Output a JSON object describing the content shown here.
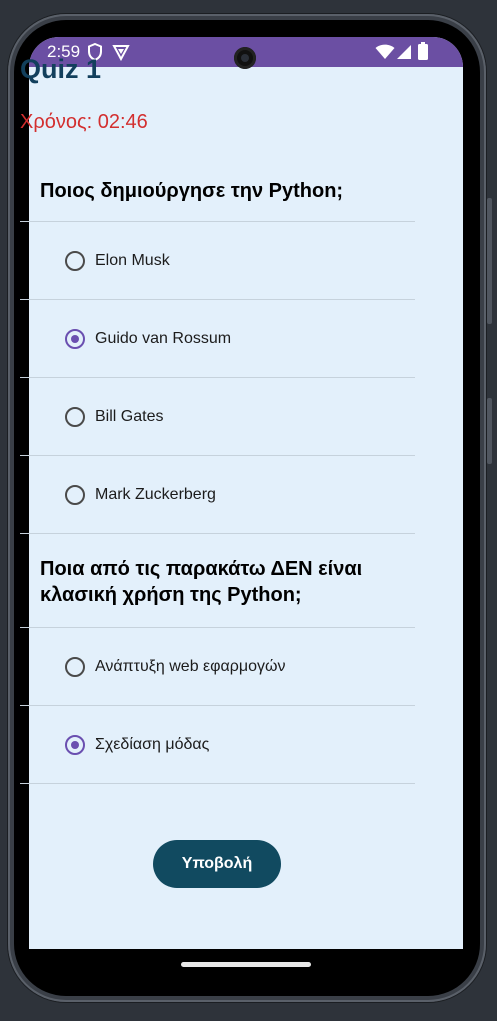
{
  "status_bar": {
    "time": "2:59",
    "left_icons": [
      "shield-icon",
      "vpn-icon"
    ],
    "right_icons": [
      "wifi-icon",
      "signal-icon",
      "battery-icon"
    ],
    "color": "#6b4fa3"
  },
  "quiz": {
    "title": "Quiz 1",
    "timer": "Χρόνος: 02:46",
    "questions": [
      {
        "text": "Ποιος δημιούργησε την Python;",
        "options": [
          {
            "label": "Elon Musk",
            "selected": false
          },
          {
            "label": "Guido van Rossum",
            "selected": true
          },
          {
            "label": "Bill Gates",
            "selected": false
          },
          {
            "label": "Mark Zuckerberg",
            "selected": false
          }
        ]
      },
      {
        "text": "Ποια από τις παρακάτω ΔΕΝ είναι κλασική χρήση της Python;",
        "options": [
          {
            "label": "Ανάπτυξη web εφαρμογών",
            "selected": false
          },
          {
            "label": "Σχεδίαση μόδας",
            "selected": true
          }
        ]
      }
    ],
    "submit_label": "Υποβολή"
  },
  "colors": {
    "accent": "#6a4fb0",
    "title": "#123f5c",
    "timer": "#d32f2f",
    "button": "#114a60",
    "background": "#e3f0fb"
  }
}
